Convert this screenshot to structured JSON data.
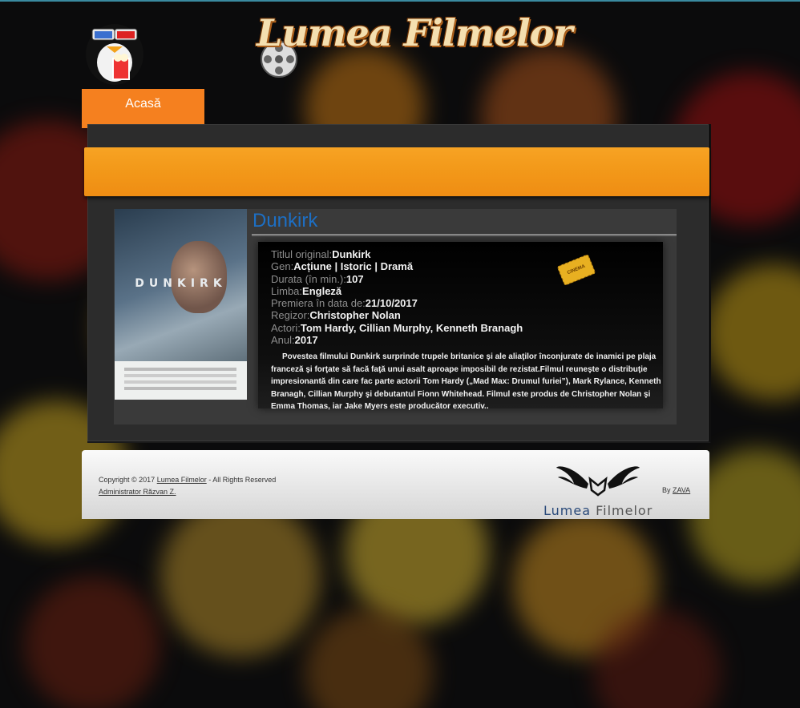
{
  "site": {
    "logo_text": "Lumea Filmelor",
    "mascot_icon": "penguin-3d-glasses-popcorn-icon"
  },
  "nav": {
    "items": [
      {
        "label": "Acasă"
      }
    ]
  },
  "movie": {
    "title": "Dunkirk",
    "poster_text": "DUNKIRK",
    "details": [
      {
        "label": "Titlul original:",
        "value": "Dunkirk"
      },
      {
        "label": "Gen:",
        "value": "Acțiune | Istoric | Dramă"
      },
      {
        "label": "Durata (în min.):",
        "value": "107"
      },
      {
        "label": "Limba:",
        "value": "Engleză"
      },
      {
        "label": "Premiera în data de:",
        "value": "21/10/2017"
      },
      {
        "label": "Regizor:",
        "value": "Christopher Nolan"
      },
      {
        "label": "Actori:",
        "value": "Tom Hardy, Cillian Murphy, Kenneth Branagh"
      },
      {
        "label": "Anul:",
        "value": "2017"
      }
    ],
    "ticket_text": "CINEMA",
    "synopsis": "Povestea filmului Dunkirk surprinde trupele britanice şi ale aliaţilor înconjurate de inamici pe plaja franceză şi forţate să facă faţă unui asalt aproape imposibil de rezistat.Filmul reuneşte o distribuţie impresionantă din care fac parte actorii Tom Hardy („Mad Max: Drumul furiei”), Mark Rylance, Kenneth Branagh, Cillian Murphy şi debutantul Fionn Whitehead. Filmul este produs de Christopher Nolan şi Emma Thomas, iar Jake Myers este producător executiv.."
  },
  "footer": {
    "copyright_prefix": "Copyright © 2017 ",
    "copyright_link": "Lumea Filmelor",
    "copyright_suffix": " - All Rights Reserved",
    "admin": "Administrator Răzvan Z.",
    "by_prefix": "By ",
    "by_link": "ZAVA",
    "logo_text": "Lumea Filmelor"
  },
  "colors": {
    "accent_orange": "#f5801f",
    "title_blue": "#1d6fc4",
    "footer_logo_blue": "#2a4a7a"
  }
}
